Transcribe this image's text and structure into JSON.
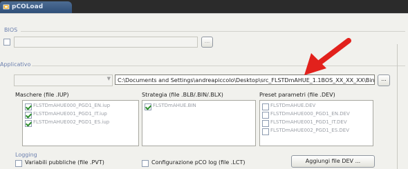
{
  "window": {
    "tab_title": "pCOLoad",
    "icon": "app-icon"
  },
  "bios": {
    "label": "BIOS",
    "file_value": "",
    "browse_label": "..."
  },
  "applicativo": {
    "label": "Applicativo",
    "path_value": "C:\\Documents and Settings\\andreapiccolo\\Desktop\\src_FLSTDmAHUE_1.1BOS_XX_XX_XX\\Bin\\Targ",
    "browse_label": "..."
  },
  "maschere": {
    "label": "Maschere (file .IUP)",
    "items": [
      {
        "checked": true,
        "text": "FLSTDmAHUE000_PGD1_EN.iup"
      },
      {
        "checked": true,
        "text": "FLSTDmAHUE001_PGD1_IT.iup"
      },
      {
        "checked": true,
        "text": "FLSTDmAHUE002_PGD1_ES.iup"
      }
    ]
  },
  "strategia": {
    "label": "Strategia (file .BLB/.BIN/.BLX)",
    "items": [
      {
        "checked": true,
        "text": "FLSTDmAHUE.BIN"
      }
    ]
  },
  "preset": {
    "label": "Preset parametri (file .DEV)",
    "items": [
      {
        "checked": false,
        "text": "FLSTDmAHUE.DEV"
      },
      {
        "checked": false,
        "text": "FLSTDmAHUE000_PGD1_EN.DEV"
      },
      {
        "checked": false,
        "text": "FLSTDmAHUE001_PGD1_IT.DEV"
      },
      {
        "checked": false,
        "text": "FLSTDmAHUE002_PGD1_ES.DEV"
      }
    ]
  },
  "logging": {
    "label": "Logging",
    "variabili_label": "Variabili pubbliche (file .PVT)",
    "config_label": "Configurazione pCO log (file .LCT)",
    "add_dev_button": "Aggiungi file DEV ..."
  },
  "colors": {
    "arrow": "#e2211c",
    "group_label": "#6b7fae"
  }
}
